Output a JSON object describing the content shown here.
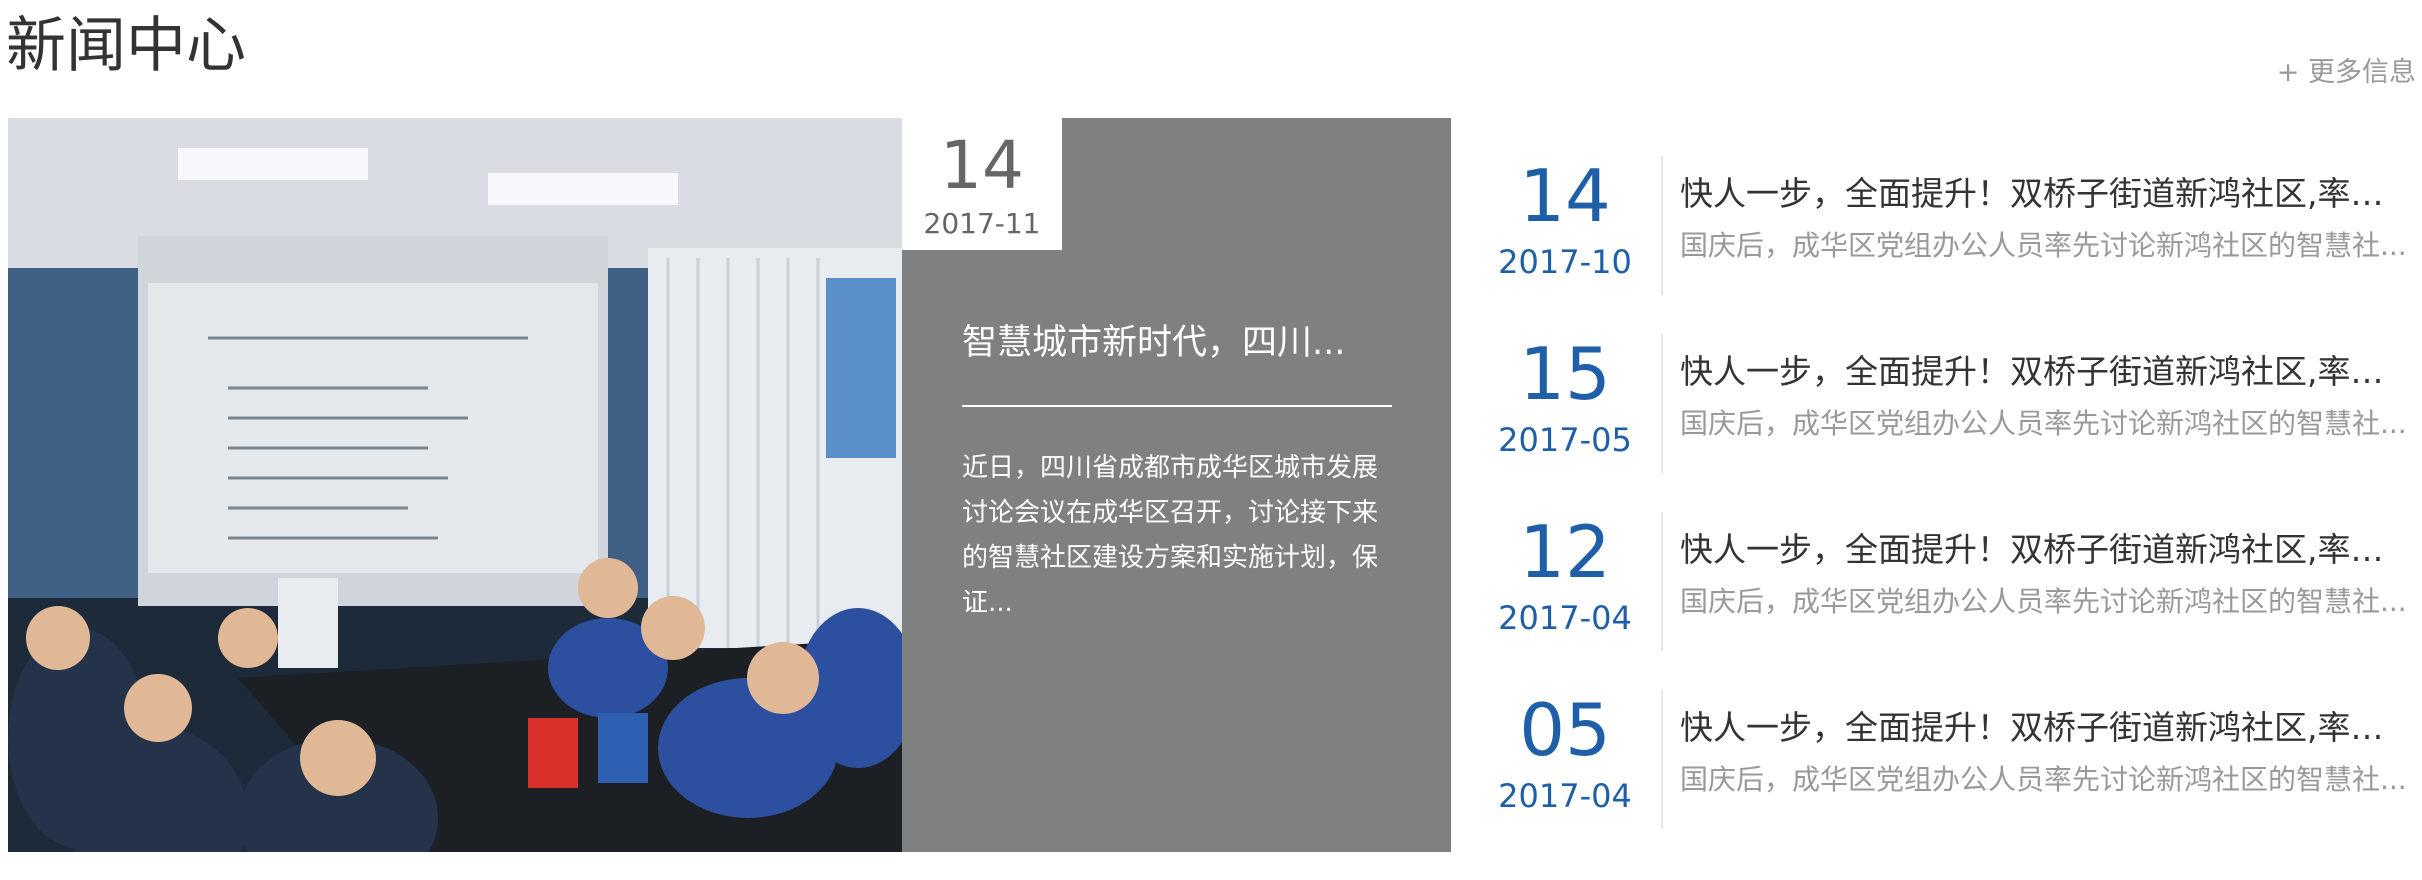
{
  "section": {
    "title": "新闻中心",
    "more_label": "+ 更多信息"
  },
  "featured": {
    "day": "14",
    "year_month": "2017-11",
    "title": "智慧城市新时代，四川...",
    "description": "近日，四川省成都市成华区城市发展讨论会议在成华区召开，讨论接下来的智慧社区建设方案和实施计划，保证..."
  },
  "news": [
    {
      "day": "14",
      "year_month": "2017-10",
      "title": "快人一步，全面提升！双桥子街道新鸿社区,率先...",
      "description": "国庆后，成华区党组办公人员率先讨论新鸿社区的智慧社..."
    },
    {
      "day": "15",
      "year_month": "2017-05",
      "title": "快人一步，全面提升！双桥子街道新鸿社区,率先...",
      "description": "国庆后，成华区党组办公人员率先讨论新鸿社区的智慧社..."
    },
    {
      "day": "12",
      "year_month": "2017-04",
      "title": "快人一步，全面提升！双桥子街道新鸿社区,率先...",
      "description": "国庆后，成华区党组办公人员率先讨论新鸿社区的智慧社..."
    },
    {
      "day": "05",
      "year_month": "2017-04",
      "title": "快人一步，全面提升！双桥子街道新鸿社区,率先...",
      "description": "国庆后，成华区党组办公人员率先讨论新鸿社区的智慧社..."
    }
  ],
  "colors": {
    "accent": "#1e5fa8",
    "panel": "#808080",
    "text": "#333333",
    "muted": "#999999"
  }
}
